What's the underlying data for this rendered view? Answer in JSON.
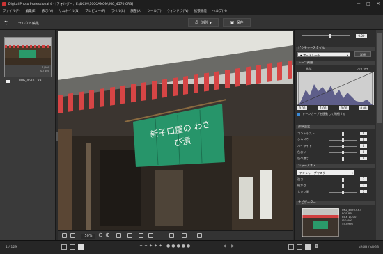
{
  "app": {
    "title": "Digital Photo Professional 4 - [フォルダー：E:\\DCIM\\100CANON\\IMG_4570.CR3]"
  },
  "window_controls": {
    "minimize": "—",
    "maximize": "□",
    "close": "✕"
  },
  "menu": [
    "ファイル(F)",
    "編集(E)",
    "表示(V)",
    "サムネイル(N)",
    "プレビュー(P)",
    "ラベル(L)",
    "調整(A)",
    "ツール(T)",
    "ウィンドウ(W)",
    "拡張機能",
    "ヘルプ(H)"
  ],
  "toolbar": {
    "back_icon": "return-arrow-icon",
    "mode_label": "セレクト編集",
    "print_label": "印刷",
    "save_label": "保存"
  },
  "filmstrip": {
    "thumb_name": "IMG_4570.CR3",
    "thumb_info_1": "1/200",
    "thumb_info_2": "ISO 400"
  },
  "image": {
    "banner_text": "新子口屋の わさび漬"
  },
  "right_panel": {
    "exposure": "0.00",
    "picture_style_section": "ピクチャースタイル",
    "picture_style_value": "ポートレート",
    "picture_style_btn": "詳細",
    "tone_section": "トーン調整",
    "tone_shadow": "暗部",
    "tone_highlight": "ハイライ",
    "levels": [
      "0.00",
      "1.00",
      "0.00",
      "0.00"
    ],
    "auto_label": "トーンカーブを連動して明細する",
    "detail_section": "詳細設定",
    "sliders": [
      {
        "label": "コントラスト",
        "value": "0"
      },
      {
        "label": "シャドウ",
        "value": "0"
      },
      {
        "label": "ハイライト",
        "value": "0"
      },
      {
        "label": "色あい",
        "value": "0"
      },
      {
        "label": "色の濃さ",
        "value": "0"
      }
    ],
    "sharpness_section": "シャープネス",
    "sharpness_mode": "アンシャープマスク",
    "sharp_sliders": [
      {
        "label": "強さ",
        "value": "3"
      },
      {
        "label": "細かさ",
        "value": "2"
      },
      {
        "label": "しきい値",
        "value": "3"
      }
    ],
    "navigator_section": "ナビゲーター",
    "nav_info": [
      "IMG_4570.CR3",
      "EOS R5",
      "F5.6 1/200",
      "ISO 400",
      "55.0mm"
    ]
  },
  "bottom": {
    "zoom": "50%",
    "page_indicator": "1 / 129"
  },
  "status": {
    "left": "1 / 129",
    "right": "sRGB / sRGB"
  }
}
